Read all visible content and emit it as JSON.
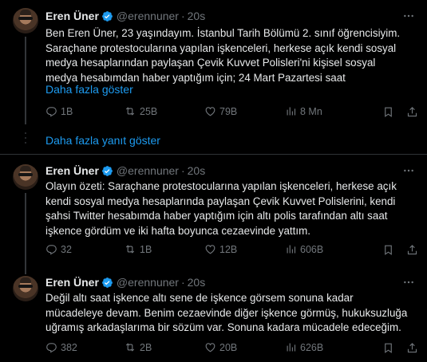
{
  "tweets": [
    {
      "name": "Eren Üner",
      "handle": "@erennuner",
      "time": "20s",
      "text": "Ben Eren Üner, 23 yaşındayım. İstanbul Tarih Bölümü 2. sınıf öğrencisiyim.\nSaraçhane protestocularına yapılan işkenceleri, herkese açık kendi sosyal\nmedya hesaplarından paylaşan Çevik Kuvvet Polisleri'ni kişisel sosyal\nmedya hesabımdan haber yaptığım için; 24 Mart Pazartesi saat",
      "show_more": "Daha fazla göster",
      "replies": "1B",
      "retweets": "25B",
      "likes": "79B",
      "views": "8 Mn"
    },
    {
      "name": "Eren Üner",
      "handle": "@erennuner",
      "time": "20s",
      "text": "Olayın özeti: Saraçhane protestocularına yapılan işkenceleri, herkese açık\nkendi sosyal medya hesaplarında paylaşan Çevik Kuvvet Polislerini, kendi\nşahsi Twitter hesabımda haber yaptığım için altı polis tarafından altı saat\nişkence gördüm ve iki hafta boyunca cezaevinde yattım.",
      "replies": "32",
      "retweets": "1B",
      "likes": "12B",
      "views": "606B"
    },
    {
      "name": "Eren Üner",
      "handle": "@erennuner",
      "time": "20s",
      "text": "Değil altı saat işkence altı sene de işkence görsem sonuna kadar\nmücadeleye devam. Benim cezaevinde diğer işkence görmüş, hukuksuzluğa\nuğramış arkadaşlarıma bir sözüm var. Sonuna kadara mücadele edeceğim.",
      "replies": "382",
      "retweets": "2B",
      "likes": "20B",
      "views": "626B"
    }
  ],
  "show_more_replies": "Daha fazla yanıt göster",
  "colors": {
    "background": "#000000",
    "text": "#e7e9ea",
    "muted": "#71767b",
    "link": "#1d9bf0",
    "verified": "#1d9bf0"
  },
  "icons": [
    "verified-badge-icon",
    "more-icon",
    "reply-icon",
    "retweet-icon",
    "like-icon",
    "views-icon",
    "bookmark-icon",
    "share-icon"
  ]
}
